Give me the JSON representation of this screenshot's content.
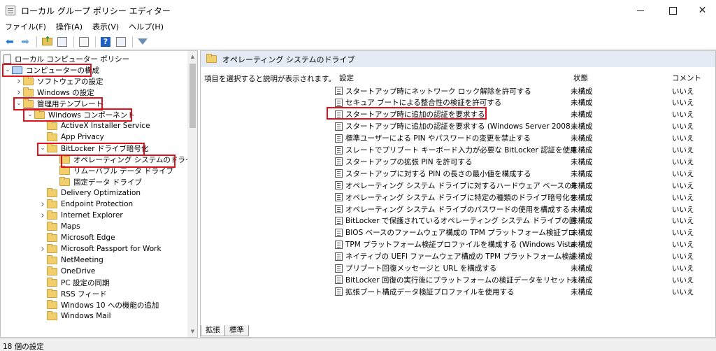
{
  "window": {
    "title": "ローカル グループ ポリシー エディター"
  },
  "menu": [
    {
      "label": "ファイル(F)"
    },
    {
      "label": "操作(A)"
    },
    {
      "label": "表示(V)"
    },
    {
      "label": "ヘルプ(H)"
    }
  ],
  "toolbar": {
    "icons": [
      "back-arrow-icon",
      "forward-arrow-icon",
      "folder-up-icon",
      "show-hide-tree-icon",
      "export-list-icon",
      "help-icon",
      "properties-icon",
      "filter-icon"
    ]
  },
  "tree": {
    "root": "ローカル コンピューター ポリシー",
    "items": [
      {
        "label": "コンピューターの構成",
        "expander": "v",
        "icon": "pc"
      },
      {
        "label": "ソフトウェアの設定",
        "expander": ">",
        "icon": "folder"
      },
      {
        "label": "Windows の設定",
        "expander": ">",
        "icon": "folder"
      },
      {
        "label": "管理用テンプレート",
        "expander": "v",
        "icon": "folder"
      },
      {
        "label": "Windows コンポーネント",
        "expander": "v",
        "icon": "folder"
      },
      {
        "label": "ActiveX Installer Service",
        "expander": "",
        "icon": "folder"
      },
      {
        "label": "App Privacy",
        "expander": "",
        "icon": "folder"
      },
      {
        "label": "BitLocker ドライブ暗号化",
        "expander": "v",
        "icon": "folder"
      },
      {
        "label": "オペレーティング システムのドライブ",
        "expander": "",
        "icon": "folder"
      },
      {
        "label": "リムーバブル データ ドライブ",
        "expander": "",
        "icon": "folder"
      },
      {
        "label": "固定データ ドライブ",
        "expander": "",
        "icon": "folder"
      },
      {
        "label": "Delivery Optimization",
        "expander": "",
        "icon": "folder"
      },
      {
        "label": "Endpoint Protection",
        "expander": ">",
        "icon": "folder"
      },
      {
        "label": "Internet Explorer",
        "expander": ">",
        "icon": "folder"
      },
      {
        "label": "Maps",
        "expander": "",
        "icon": "folder"
      },
      {
        "label": "Microsoft Edge",
        "expander": "",
        "icon": "folder"
      },
      {
        "label": "Microsoft Passport for Work",
        "expander": ">",
        "icon": "folder"
      },
      {
        "label": "NetMeeting",
        "expander": "",
        "icon": "folder"
      },
      {
        "label": "OneDrive",
        "expander": "",
        "icon": "folder"
      },
      {
        "label": "PC 設定の同期",
        "expander": "",
        "icon": "folder"
      },
      {
        "label": "RSS フィード",
        "expander": "",
        "icon": "folder"
      },
      {
        "label": "Windows 10 への機能の追加",
        "expander": "",
        "icon": "folder"
      },
      {
        "label": "Windows Mail",
        "expander": "",
        "icon": "folder"
      }
    ]
  },
  "right": {
    "header": "オペレーティング システムのドライブ",
    "description": "項目を選択すると説明が表示されます。",
    "columns": {
      "setting": "設定",
      "state": "状態",
      "comment": "コメント"
    },
    "settings": [
      {
        "name": "スタートアップ時にネットワーク ロック解除を許可する",
        "state": "未構成",
        "comment": "いいえ"
      },
      {
        "name": "セキュア ブートによる整合性の検証を許可する",
        "state": "未構成",
        "comment": "いいえ"
      },
      {
        "name": "スタートアップ時に追加の認証を要求する",
        "state": "未構成",
        "comment": "いいえ"
      },
      {
        "name": "スタートアップ時に追加の認証を要求する (Windows Server 2008 ...",
        "state": "未構成",
        "comment": "いいえ"
      },
      {
        "name": "標準ユーザーによる PIN やパスワードの変更を禁止する",
        "state": "未構成",
        "comment": "いいえ"
      },
      {
        "name": "スレートでプリブート キーボード入力が必要な BitLocker 認証を使用...",
        "state": "未構成",
        "comment": "いいえ"
      },
      {
        "name": "スタートアップの拡張 PIN を許可する",
        "state": "未構成",
        "comment": "いいえ"
      },
      {
        "name": "スタートアップに対する PIN の長さの最小値を構成する",
        "state": "未構成",
        "comment": "いいえ"
      },
      {
        "name": "オペレーティング システム ドライブに対するハードウェア ベースの暗号化...",
        "state": "未構成",
        "comment": "いいえ"
      },
      {
        "name": "オペレーティング システム ドライブに特定の種類のドライブ暗号化を適...",
        "state": "未構成",
        "comment": "いいえ"
      },
      {
        "name": "オペレーティング システム ドライブのパスワードの使用を構成する",
        "state": "未構成",
        "comment": "いいえ"
      },
      {
        "name": "BitLocker で保護されているオペレーティング システム ドライブの回復...",
        "state": "未構成",
        "comment": "いいえ"
      },
      {
        "name": "BIOS ベースのファームウェア構成の TPM プラットフォーム検証プロファイ...",
        "state": "未構成",
        "comment": "いいえ"
      },
      {
        "name": "TPM プラットフォーム検証プロファイルを構成する (Windows Vista, ...",
        "state": "未構成",
        "comment": "いいえ"
      },
      {
        "name": "ネイティブの UEFI ファームウェア構成の TPM プラットフォーム検証プロ...",
        "state": "未構成",
        "comment": "いいえ"
      },
      {
        "name": "プリブート回復メッセージと URL を構成する",
        "state": "未構成",
        "comment": "いいえ"
      },
      {
        "name": "BitLocker 回復の実行後にプラットフォームの検証データをリセットする",
        "state": "未構成",
        "comment": "いいえ"
      },
      {
        "name": "拡張ブート構成データ検証プロファイルを使用する",
        "state": "未構成",
        "comment": "いいえ"
      }
    ]
  },
  "tabs": [
    {
      "label": "拡張"
    },
    {
      "label": "標準"
    }
  ],
  "status": {
    "text": "18 個の設定"
  },
  "colors": {
    "highlight": "#e0111a",
    "header_bg": "#e4ebf5"
  }
}
